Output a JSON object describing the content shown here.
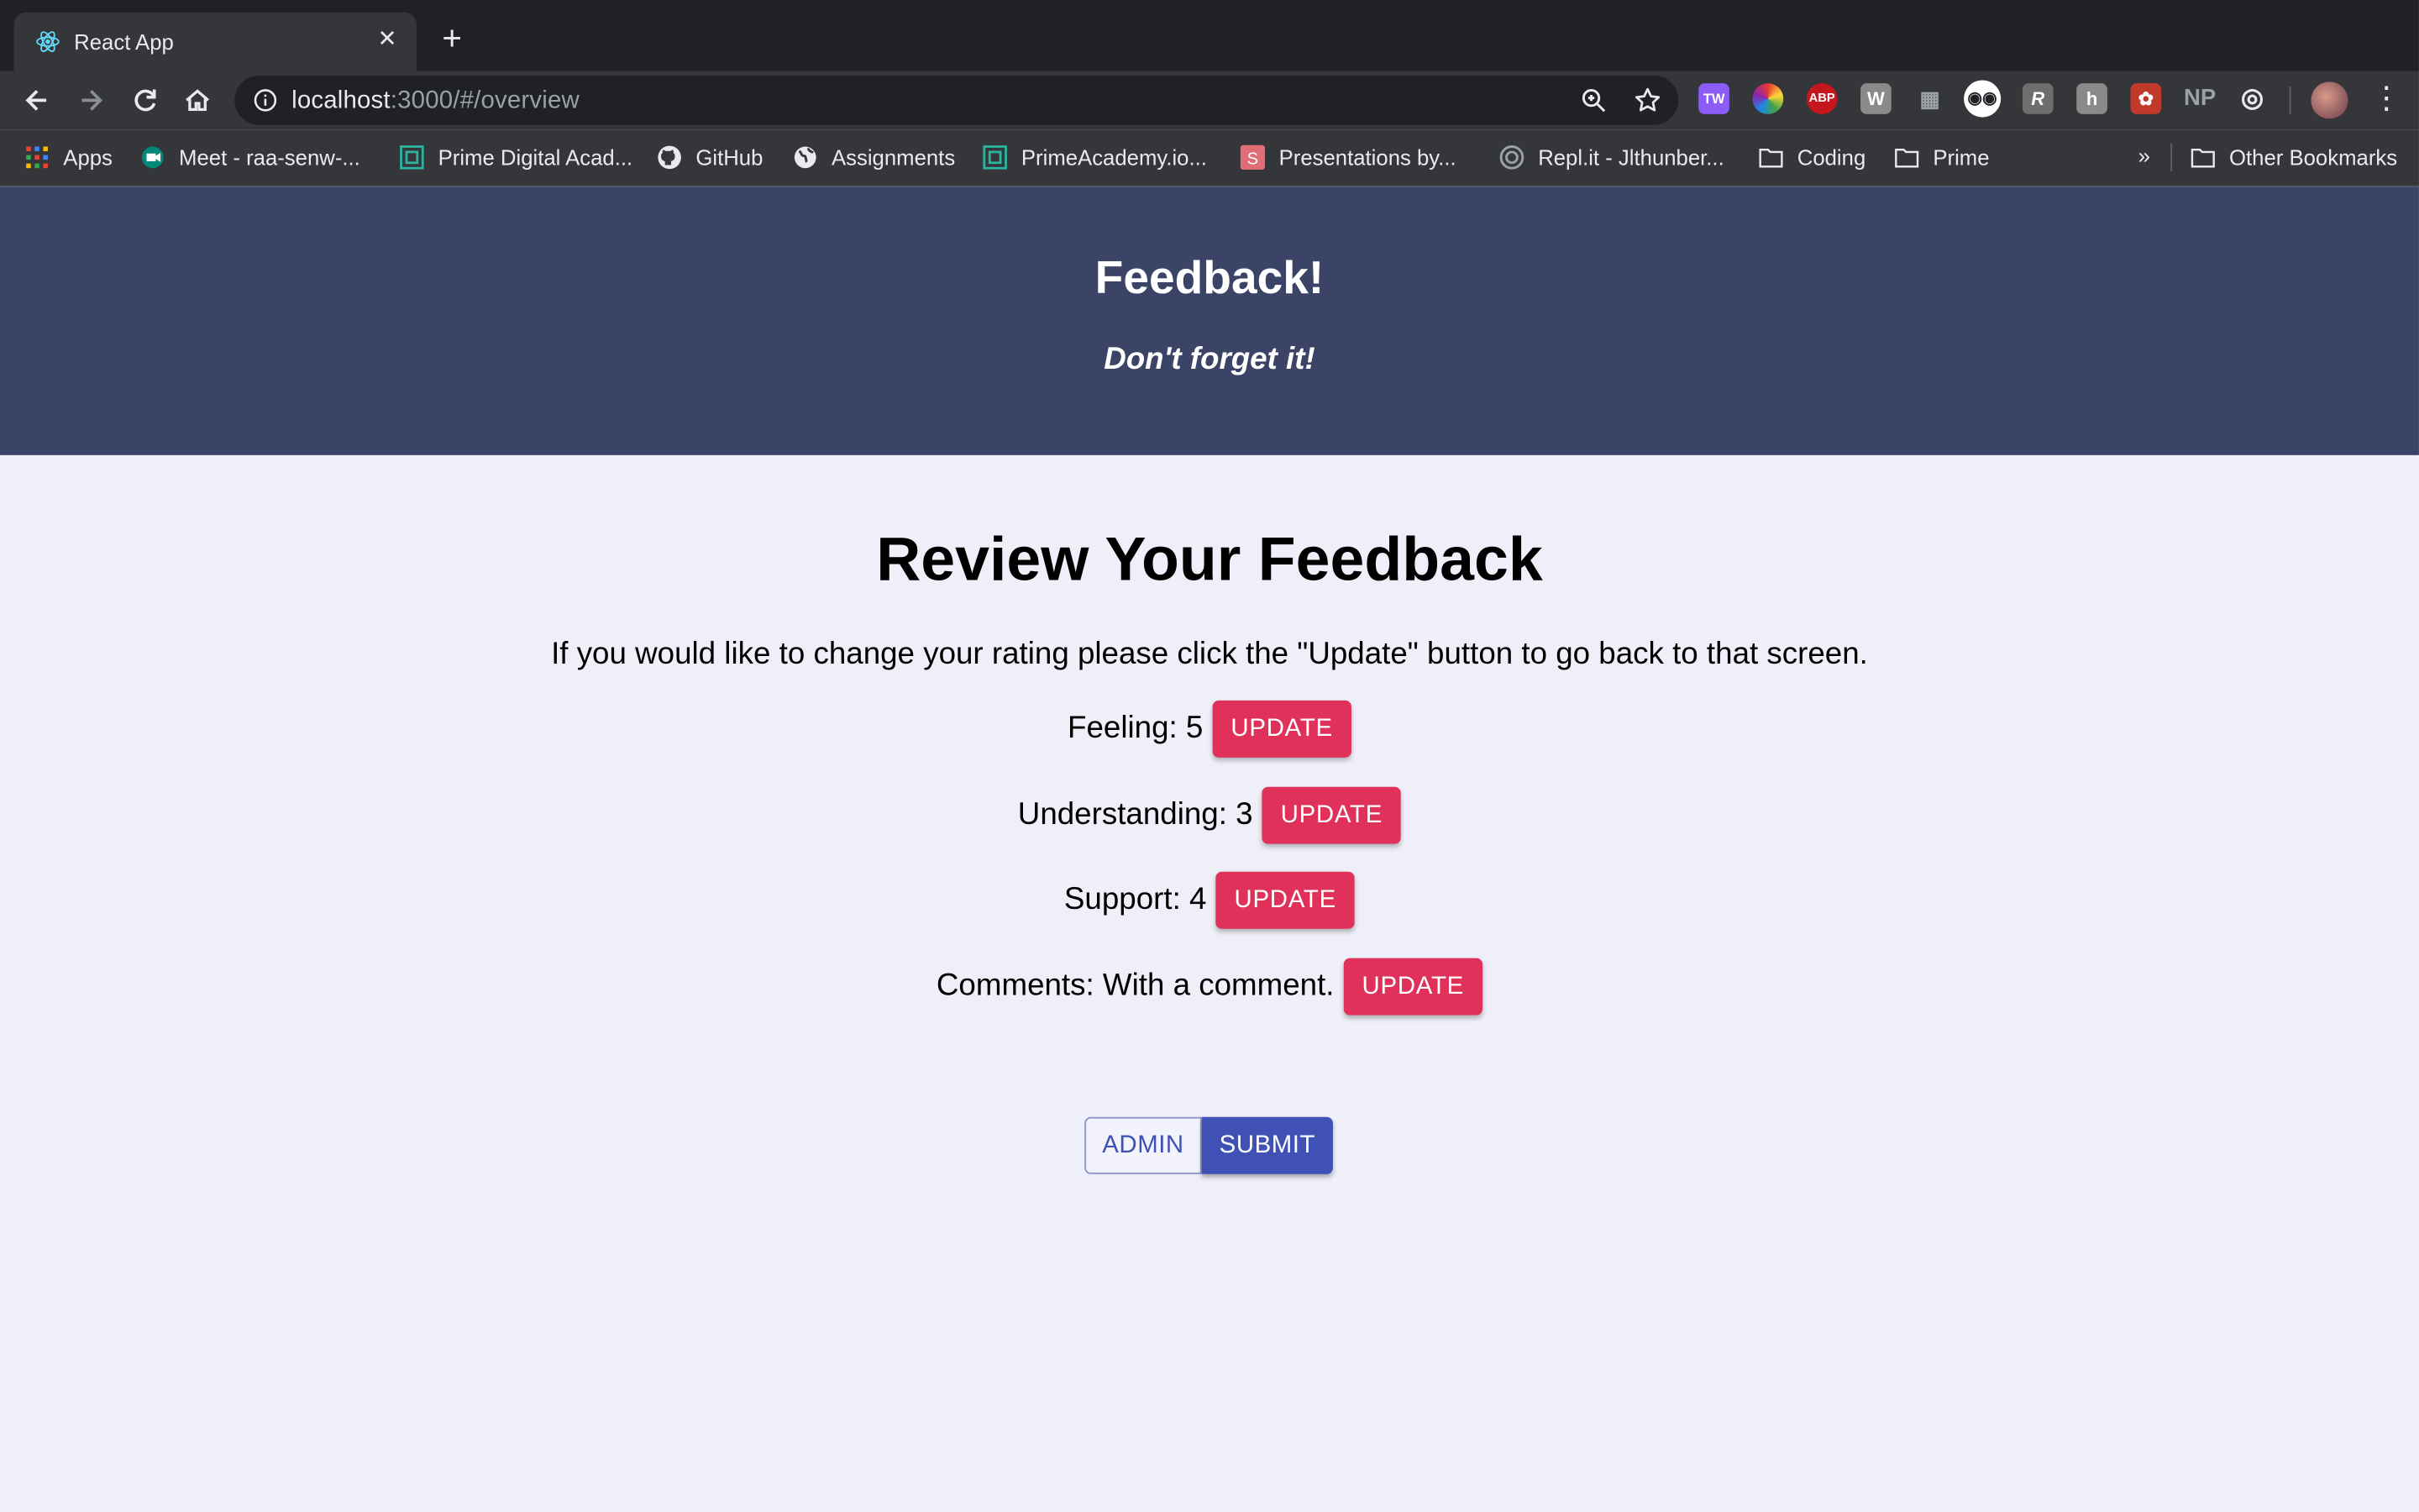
{
  "browser": {
    "tab_title": "React App",
    "tab_close": "✕",
    "new_tab": "+",
    "url_host": "localhost",
    "url_rest": ":3000/#/overview",
    "menu": "⋮",
    "bookmarks": [
      {
        "label": "Apps",
        "icon": "apps-grid-icon"
      },
      {
        "label": "Meet - raa-senw-...",
        "icon": "meet-icon"
      },
      {
        "label": "Prime Digital Acad...",
        "icon": "prime-icon"
      },
      {
        "label": "GitHub",
        "icon": "github-icon"
      },
      {
        "label": "Assignments",
        "icon": "globe-icon"
      },
      {
        "label": "PrimeAcademy.io...",
        "icon": "prime-icon"
      },
      {
        "label": "Presentations by...",
        "icon": "slides-icon"
      },
      {
        "label": "Repl.it - Jlthunber...",
        "icon": "replit-icon"
      },
      {
        "label": "Coding",
        "icon": "folder-icon"
      },
      {
        "label": "Prime",
        "icon": "folder-icon"
      }
    ],
    "bookmarks_more": "»",
    "other_bookmarks": "Other Bookmarks",
    "extensions": [
      {
        "label": "TW",
        "color": "#8b5cf6"
      },
      {
        "label": "",
        "color": "#e44"
      },
      {
        "label": "ABP",
        "color": "#c4161c"
      },
      {
        "label": "W",
        "color": "#8a8a8a"
      },
      {
        "label": "",
        "color": "#444"
      },
      {
        "label": "",
        "color": "#ffffff"
      },
      {
        "label": "R",
        "color": "#6e6e6e"
      },
      {
        "label": "h",
        "color": "#8a8a8a"
      },
      {
        "label": "",
        "color": "#c0392b"
      },
      {
        "label": "NP",
        "color": "#35363a"
      },
      {
        "label": "",
        "color": "#35363a"
      }
    ]
  },
  "header": {
    "title": "Feedback!",
    "subtitle": "Don't forget it!"
  },
  "review": {
    "title": "Review Your Feedback",
    "instructions": "If you would like to change your rating please click the \"Update\" button to go back to that screen.",
    "items": [
      {
        "label": "Feeling: 5",
        "button": "UPDATE"
      },
      {
        "label": "Understanding: 3",
        "button": "UPDATE"
      },
      {
        "label": "Support: 4",
        "button": "UPDATE"
      },
      {
        "label": "Comments: With a comment.",
        "button": "UPDATE"
      }
    ],
    "admin_label": "ADMIN",
    "submit_label": "SUBMIT"
  },
  "colors": {
    "header_bg": "#3b4466",
    "update_button": "#e0315a",
    "submit_button": "#3f51b5",
    "page_bg": "#eeeff8"
  }
}
